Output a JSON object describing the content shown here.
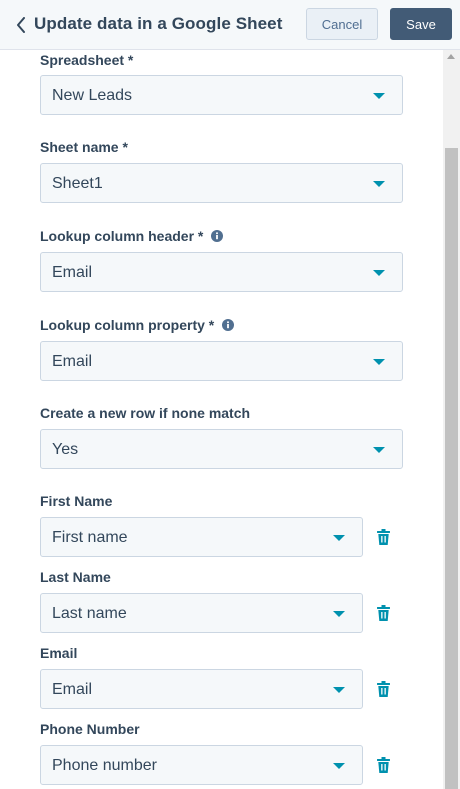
{
  "header": {
    "title": "Update data in a Google Sheet",
    "cancel_label": "Cancel",
    "save_label": "Save"
  },
  "fields": [
    {
      "label": "Spreadsheet *",
      "value": "New Leads",
      "info": false
    },
    {
      "label": "Sheet name *",
      "value": "Sheet1",
      "info": false
    },
    {
      "label": "Lookup column header *",
      "value": "Email",
      "info": true
    },
    {
      "label": "Lookup column property *",
      "value": "Email",
      "info": true
    },
    {
      "label": "Create a new row if none match",
      "value": "Yes",
      "info": false
    }
  ],
  "mappings": [
    {
      "label": "First Name",
      "value": "First name"
    },
    {
      "label": "Last Name",
      "value": "Last name"
    },
    {
      "label": "Email",
      "value": "Email"
    },
    {
      "label": "Phone Number",
      "value": "Phone number"
    }
  ],
  "colors": {
    "accent": "#0091ae",
    "primary_button": "#425b76",
    "text": "#33475b",
    "input_bg": "#f5f8fa",
    "border": "#cbd6e2"
  },
  "icons": {
    "back": "chevron-left-icon",
    "info": "info-icon",
    "delete": "trash-icon",
    "dropdown": "caret-down-icon"
  }
}
